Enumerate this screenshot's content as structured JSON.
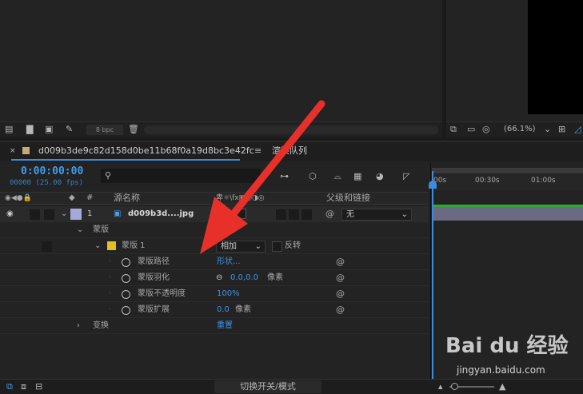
{
  "viewer": {
    "bpc": "8 bpc",
    "zoom": "(66.1%)"
  },
  "tabs": {
    "active": "d009b3de9c82d158d0be11b68f0a19d8bc3e42fc",
    "other": "渲染队列"
  },
  "timecode": {
    "time": "0:00:00:00",
    "fps": "00000 (25.00 fps)"
  },
  "search": {
    "placeholder": ""
  },
  "columns": {
    "index": "#",
    "source": "源名称",
    "parent": "父级和链接"
  },
  "layers": [
    {
      "num": "1",
      "name": "d009b3d....jpg",
      "parent": "无"
    }
  ],
  "rows": {
    "masks": "蒙版",
    "mask1": "蒙版 1",
    "mask_mode": "相加",
    "invert": "反转",
    "mask_path": "蒙版路径",
    "mask_path_val": "形状...",
    "feather": "蒙版羽化",
    "feather_val": "0.0,0.0",
    "feather_unit": "像素",
    "opacity": "蒙版不透明度",
    "opacity_val": "100%",
    "expand": "蒙版扩展",
    "expand_val": "0.0",
    "expand_unit": "像素",
    "transform": "变换",
    "reset": "重置"
  },
  "ruler": {
    "t0": "00s",
    "t1": "00:30s",
    "t2": "01:00s"
  },
  "footer": {
    "toggle": "切换开关/模式"
  },
  "watermark": {
    "logo": "Bai du 经验",
    "url": "jingyan.baidu.com"
  },
  "colors": {
    "accent": "#3e9ef0",
    "arrow": "#e8302a",
    "track": "#6a6a82",
    "label_yellow": "#e0c020",
    "label_lavender": "#a8a8d8"
  }
}
